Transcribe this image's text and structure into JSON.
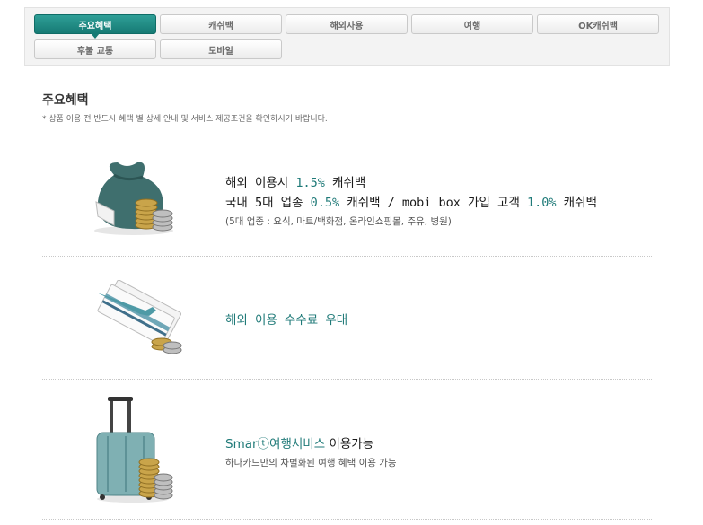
{
  "tabs": {
    "row1": [
      "주요혜택",
      "캐쉬백",
      "해외사용",
      "여행",
      "OK캐쉬백"
    ],
    "row2": [
      "후불 교통",
      "모바일"
    ],
    "active": "주요혜택"
  },
  "section": {
    "title": "주요혜택",
    "note": "* 상품 이용 전 반드시 혜택 별 상세 안내 및 서비스 제공조건을 확인하시기 바랍니다."
  },
  "benefits": [
    {
      "line1_pre": "해외 이용시 ",
      "line1_hl": "1.5%",
      "line1_post": " 캐쉬백",
      "line2_a": "국내 5대 업종 ",
      "line2_hl1": "0.5%",
      "line2_b": " 캐쉬백 / mobi box 가입 고객 ",
      "line2_hl2": "1.0%",
      "line2_c": " 캐쉬백",
      "sub": "(5대 업종 : 요식, 마트/백화점, 온라인쇼핑몰, 주유, 병원)",
      "icon": "money-bag-coins-icon"
    },
    {
      "title": "해외 이용 수수료 우대",
      "icon": "airline-ticket-coins-icon"
    },
    {
      "title_hl": "Smarⓣ여행서비스",
      "title_post": " 이용가능",
      "sub": "하나카드만의 차별화된 여행 혜택 이용 가능",
      "icon": "suitcase-coins-icon"
    }
  ],
  "colors": {
    "accent": "#1f7a78",
    "tab_active": "#1a8580"
  }
}
